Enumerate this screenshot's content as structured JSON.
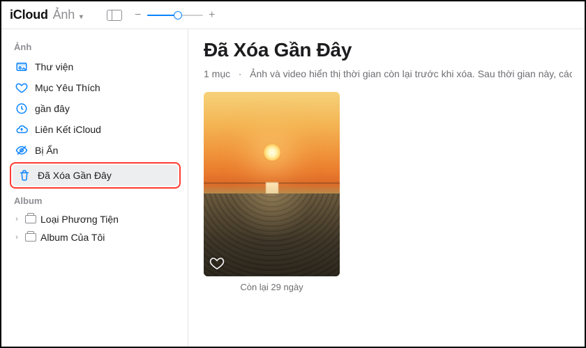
{
  "toolbar": {
    "title": "iCloud",
    "subtitle": "Ảnh",
    "zoom_percent": 55
  },
  "sidebar": {
    "section_photos": "Ảnh",
    "items": [
      {
        "icon": "library-icon",
        "label": "Thư viện"
      },
      {
        "icon": "heart-icon",
        "label": "Mục Yêu Thích"
      },
      {
        "icon": "clock-icon",
        "label": "gần đây"
      },
      {
        "icon": "cloud-icon",
        "label": "Liên Kết iCloud"
      },
      {
        "icon": "eye-off-icon",
        "label": "Bị Ẩn"
      },
      {
        "icon": "trash-icon",
        "label": "Đã Xóa Gần Đây"
      }
    ],
    "section_album": "Album",
    "albums": [
      {
        "label": "Loại Phương Tiện"
      },
      {
        "label": "Album Của Tôi"
      }
    ]
  },
  "main": {
    "title": "Đã Xóa Gần Đây",
    "subtitle_count": "1 mục",
    "subtitle_dot": "·",
    "subtitle_text": "Ảnh và video hiển thị thời gian còn lại trước khi xóa. Sau thời gian này, các n",
    "photos": [
      {
        "caption": "Còn lại 29 ngày"
      }
    ]
  }
}
